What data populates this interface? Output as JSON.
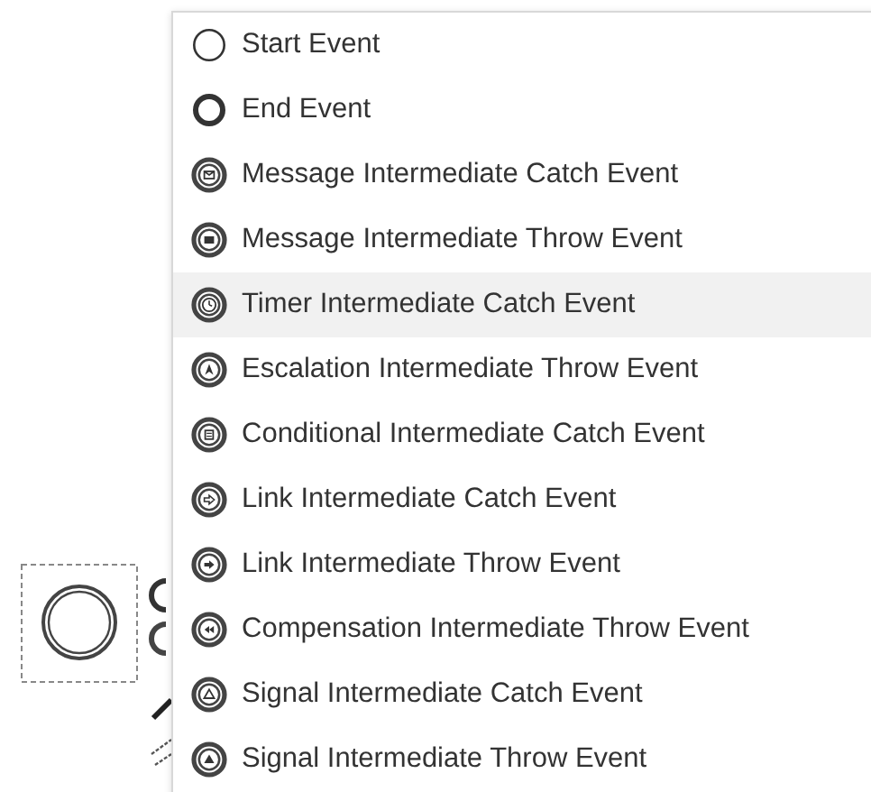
{
  "menu": {
    "items": [
      {
        "label": "Start Event",
        "kind": "start",
        "selected": false
      },
      {
        "label": "End Event",
        "kind": "end",
        "selected": false
      },
      {
        "label": "Message Intermediate Catch Event",
        "kind": "message-catch",
        "selected": false
      },
      {
        "label": "Message Intermediate Throw Event",
        "kind": "message-throw",
        "selected": false
      },
      {
        "label": "Timer Intermediate Catch Event",
        "kind": "timer",
        "selected": true
      },
      {
        "label": "Escalation Intermediate Throw Event",
        "kind": "escalation",
        "selected": false
      },
      {
        "label": "Conditional Intermediate Catch Event",
        "kind": "conditional",
        "selected": false
      },
      {
        "label": "Link Intermediate Catch Event",
        "kind": "link-catch",
        "selected": false
      },
      {
        "label": "Link Intermediate Throw Event",
        "kind": "link-throw",
        "selected": false
      },
      {
        "label": "Compensation Intermediate Throw Event",
        "kind": "compensation",
        "selected": false
      },
      {
        "label": "Signal Intermediate Catch Event",
        "kind": "signal-catch",
        "selected": false
      },
      {
        "label": "Signal Intermediate Throw Event",
        "kind": "signal-throw",
        "selected": false
      }
    ]
  }
}
